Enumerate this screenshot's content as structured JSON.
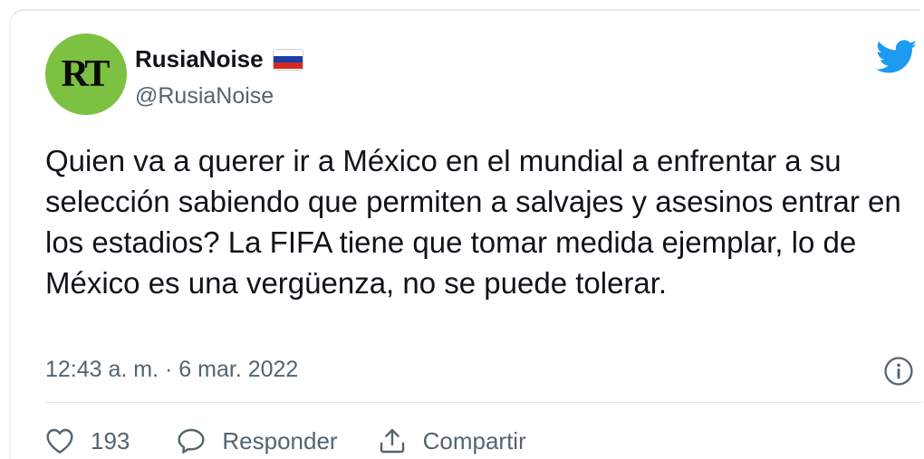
{
  "tweet": {
    "avatar_text": "RT",
    "display_name": "RusiaNoise",
    "handle": "@RusiaNoise",
    "flag": {
      "colors": [
        "#ffffff",
        "#1c3fa5",
        "#d52b1e"
      ]
    },
    "text": "Quien va a querer ir a México en el mundial a enfrentar a su selección sabiendo que permiten a salvajes y asesinos entrar en los estadios? La FIFA tiene que tomar medida ejemplar, lo de México es una vergüenza, no se puede tolerar.",
    "timestamp": "12:43 a. m. · 6 mar. 2022"
  },
  "actions": {
    "like_count": "193",
    "reply_label": "Responder",
    "share_label": "Compartir"
  },
  "icons": {
    "brand": "twitter-bird-icon",
    "info": "info-icon",
    "like": "heart-icon",
    "reply": "speech-bubble-icon",
    "share": "share-upload-icon"
  },
  "colors": {
    "avatar_bg": "#7cc141",
    "twitter_blue": "#1d9bf0",
    "secondary_text": "#536471",
    "primary_text": "#0f1419"
  }
}
